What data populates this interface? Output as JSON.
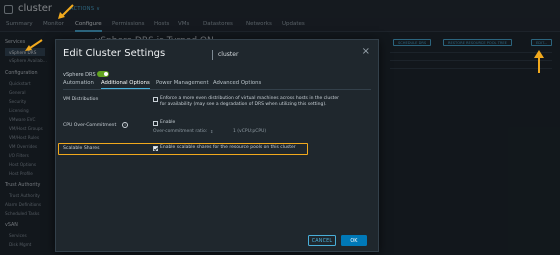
{
  "app": {
    "title": "cluster",
    "actions_label": "ACTIONS ∨"
  },
  "nav_tabs": [
    "Summary",
    "Monitor",
    "Configure",
    "Permissions",
    "Hosts",
    "VMs",
    "Datastores",
    "Networks",
    "Updates"
  ],
  "sidebar": {
    "services_head": "Services",
    "vsphere_drs": "vSphere DRS",
    "vsphere_avail": "vSphere Availab...",
    "config_head": "Configuration",
    "items": [
      "Quickstart",
      "General",
      "Security",
      "Licensing",
      "VMware EVC",
      "VM/Host Groups",
      "VM/Host Rules",
      "VM Overrides",
      "I/O Filters",
      "Host Options",
      "Host Profile"
    ],
    "trust_head": "Trust Authority",
    "trust_items": [
      "Trust Authority"
    ],
    "other_items": [
      "Alarm Definitions",
      "Scheduled Tasks"
    ],
    "vsan_head": "vSAN",
    "vsan_items": [
      "Services",
      "Disk Mgmt"
    ]
  },
  "background": {
    "page_title": "vSphere DRS is Turned ON",
    "buttons": [
      "SCHEDULE DRS",
      "RESTORE RESOURCE POOL TREE",
      "EDIT..."
    ]
  },
  "modal": {
    "title": "Edit Cluster Settings",
    "subtitle": "cluster",
    "drs_label": "vSphere DRS",
    "tabs": [
      "Automation",
      "Additional Options",
      "Power Management",
      "Advanced Options"
    ],
    "vm_distribution": {
      "label": "VM Distribution",
      "text": "Enforce a more even distribution of virtual machines across hosts in the cluster for availability (may see a degradation of DRS when utilizing this setting)."
    },
    "cpu_over_commitment": {
      "label": "CPU Over-Commitment",
      "enable_text": "Enable",
      "ratio_label": "Over-commitment ratio:",
      "ratio_value": "1 (vCPU:pCPU)"
    },
    "scalable_shares": {
      "label": "Scalable Shares",
      "text": "Enable scalable shares for the resource pools on this cluster"
    },
    "cancel_label": "CANCEL",
    "ok_label": "OK"
  },
  "colors": {
    "accent": "#49afd9",
    "highlight": "#f1a91d",
    "toggle_on": "#62a420",
    "ok_bg": "#0079b8"
  }
}
